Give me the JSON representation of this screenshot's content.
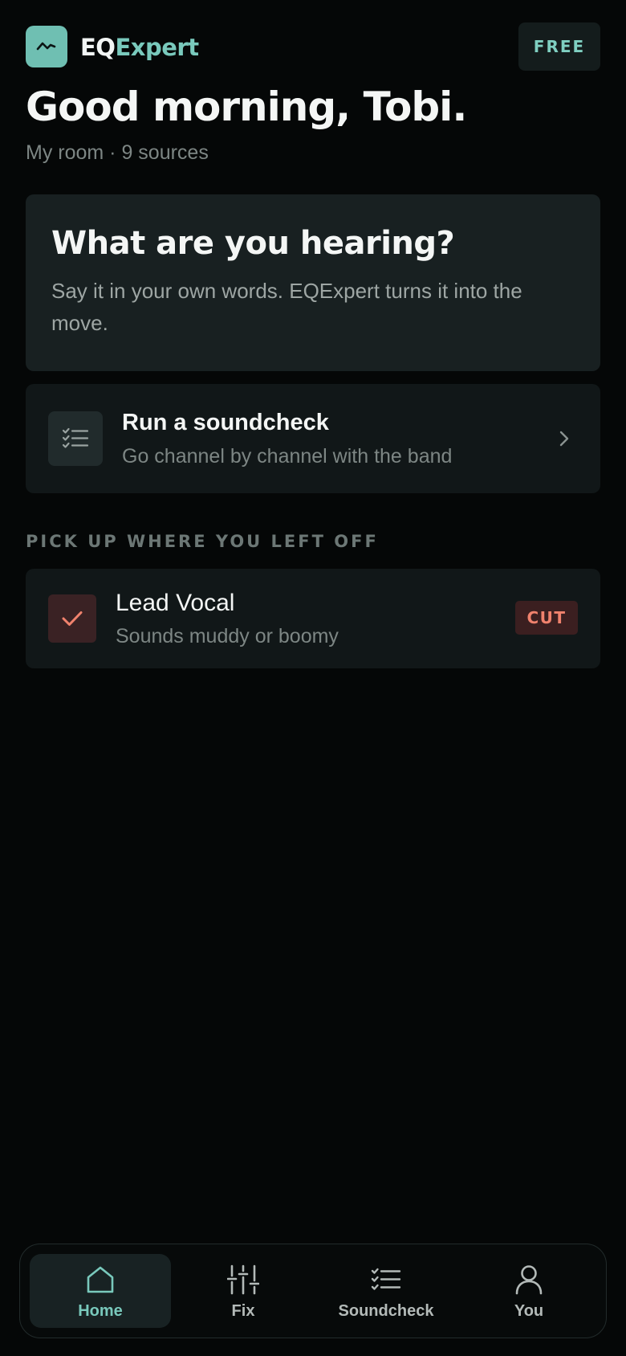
{
  "app": {
    "brand_prefix": "EQ",
    "brand_suffix": "Expert",
    "plan_badge": "FREE",
    "icon": "waveform-icon"
  },
  "home": {
    "greeting": "Good morning, Tobi.",
    "subline": "My room · 9 sources"
  },
  "hear_card": {
    "title": "What are you hearing?",
    "body": "Say it in your own words. EQExpert turns it into the move."
  },
  "soundcheck_card": {
    "title": "Run a soundcheck",
    "subtitle": "Go channel by channel with the band",
    "icon": "checklist-icon"
  },
  "resume_section": {
    "label": "PICK UP WHERE YOU LEFT OFF",
    "items": [
      {
        "title": "Lead Vocal",
        "subtitle": "Sounds muddy or boomy",
        "badge": "CUT",
        "icon": "check-icon"
      }
    ]
  },
  "tabbar": {
    "active": "Home",
    "tabs": [
      {
        "label": "Home",
        "icon": "home-icon"
      },
      {
        "label": "Fix",
        "icon": "sliders-icon"
      },
      {
        "label": "Soundcheck",
        "icon": "checklist-icon"
      },
      {
        "label": "You",
        "icon": "user-icon"
      }
    ]
  },
  "colors": {
    "background": "#050707",
    "accent": "#79c9bc",
    "card": "#182021",
    "cut_accent": "#f0826d"
  }
}
